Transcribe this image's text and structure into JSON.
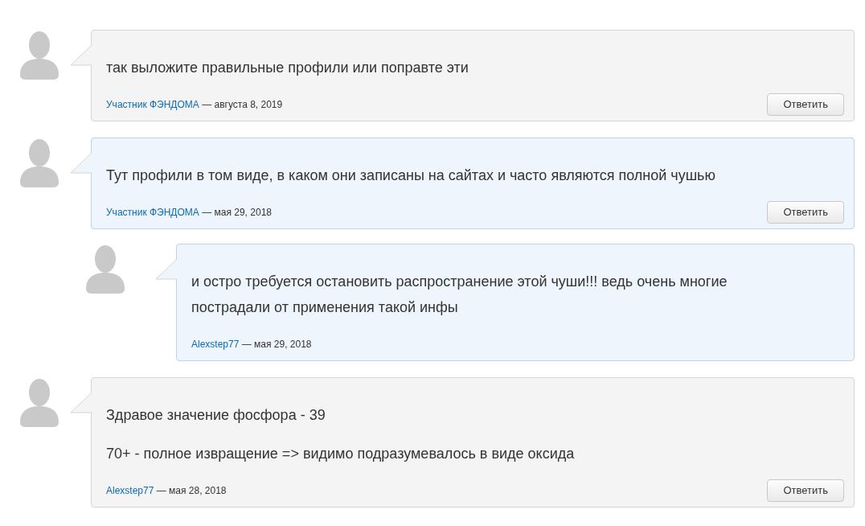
{
  "comments": [
    {
      "highlighted": false,
      "paragraphs": [
        "так выложите правильные профили или поправте эти"
      ],
      "author": "Участник ФЭНДОМА",
      "date": "— августа 8, 2019",
      "reply_button": "Ответить"
    },
    {
      "highlighted": true,
      "paragraphs": [
        "Тут профили в том виде, в каком они записаны на сайтах и часто являются полной чушью"
      ],
      "author": "Участник ФЭНДОМА",
      "date": "— мая 29, 2018",
      "reply_button": "Ответить",
      "children": [
        {
          "highlighted": true,
          "paragraphs": [
            "и остро требуется остановить распространение этой чуши!!! ведь очень многие пострадали от применения такой инфы"
          ],
          "author": "Alexstep77",
          "date": "— мая 29, 2018"
        }
      ]
    },
    {
      "highlighted": false,
      "paragraphs": [
        "Здравое значение фосфора - 39",
        "70+ - полное извращение => видимо подразумевалось в виде оксида"
      ],
      "author": "Alexstep77",
      "date": "— мая 28, 2018",
      "reply_button": "Ответить"
    }
  ]
}
